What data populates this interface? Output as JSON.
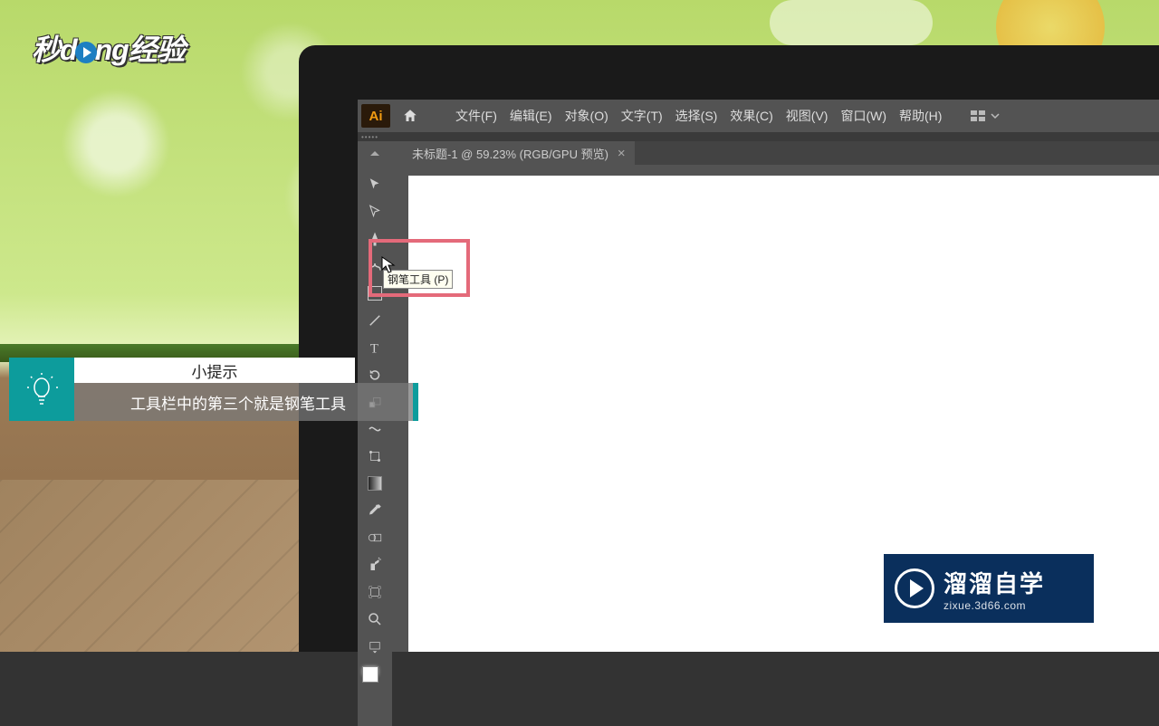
{
  "watermark": {
    "prefix": "秒d",
    "suffix": "ng经验"
  },
  "app": {
    "logo": "Ai",
    "menus": [
      "文件(F)",
      "编辑(E)",
      "对象(O)",
      "文字(T)",
      "选择(S)",
      "效果(C)",
      "视图(V)",
      "窗口(W)",
      "帮助(H)"
    ]
  },
  "tab": {
    "title": "未标题-1 @ 59.23% (RGB/GPU 预览)",
    "close": "×"
  },
  "tooltip": "钢笔工具 (P)",
  "hint": {
    "title": "小提示",
    "message": "工具栏中的第三个就是钢笔工具"
  },
  "brand": {
    "name": "溜溜自学",
    "url": "zixue.3d66.com"
  }
}
